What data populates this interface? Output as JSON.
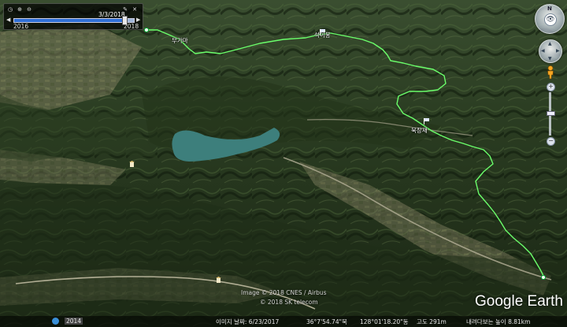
{
  "time_slider": {
    "current_date": "3/3/2018",
    "start_year": "2016",
    "end_year": "2018",
    "position_fraction": 0.93,
    "tools": [
      "clock-icon",
      "zoom-in-icon",
      "zoom-out-icon",
      "wrench-icon",
      "close-icon"
    ]
  },
  "navigation": {
    "compass_north": "N",
    "pegman_icon": "pegman-icon",
    "zoom_level_fraction": 0.45
  },
  "map": {
    "route_color": "#6bff6b",
    "water_color": "#3d7f7c",
    "place_labels": [
      "무가마",
      "석이봉",
      "묵장재"
    ]
  },
  "credits": {
    "line1": "Image © 2018 CNES / Airbus",
    "line2": "© 2018 SK telecom"
  },
  "logo": "Google Earth",
  "status_bar": {
    "year": "2014",
    "date_label": "이미지 날짜: 6/23/2017",
    "latitude": "36°7'54.74\"북",
    "longitude": "128°01'18.20\"동",
    "elevation": "고도   291m",
    "eye_alt": "내려다보는 높이   8.81km"
  }
}
